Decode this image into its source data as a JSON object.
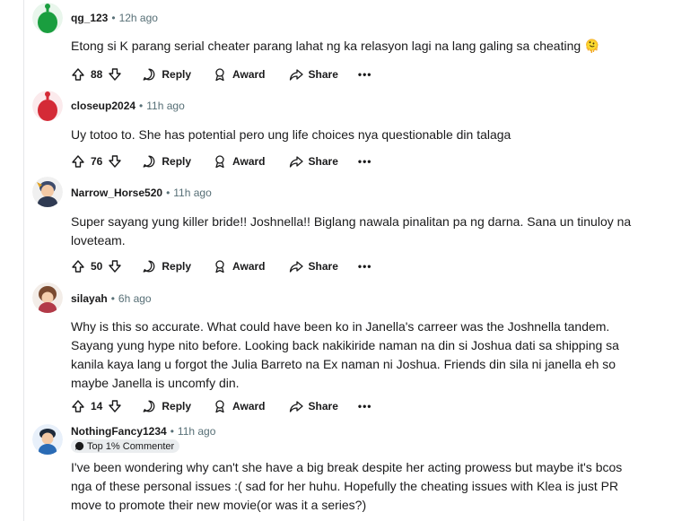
{
  "actions": {
    "reply_label": "Reply",
    "award_label": "Award",
    "share_label": "Share",
    "more_label": "•••"
  },
  "comments": [
    {
      "username": "qg_123",
      "separator": "•",
      "time": "12h ago",
      "text": "Etong si K parang serial cheater parang lahat ng ka relasyon lagi na lang galing sa cheating 🫠",
      "score": "88",
      "avatar_color": "#1a9e3f"
    },
    {
      "username": "closeup2024",
      "separator": "•",
      "time": "11h ago",
      "text": "Uy totoo to. She has potential pero ung life choices nya questionable din talaga",
      "score": "76",
      "avatar_color": "#d42a36"
    },
    {
      "username": "Narrow_Horse520",
      "separator": "•",
      "time": "11h ago",
      "text": "Super sayang yung killer bride!! Joshnella!! Biglang nawala pinalitan pa ng darna. Sana un tinuloy na loveteam.",
      "score": "50",
      "avatar_color": "#3d4b6b"
    },
    {
      "username": "silayah",
      "separator": "•",
      "time": "6h ago",
      "text": "Why is this so accurate. What could have been ko in Janella's carreer was the Joshnella tandem. Sayang yung hype nito before. Looking back nakikiride naman na din si Joshua dati sa shipping sa kanila kaya lang u forgot the Julia Barreto na Ex naman ni Joshua. Friends din sila ni janella eh so maybe Janella is uncomfy din.",
      "score": "14",
      "avatar_color": "#7a4a30"
    },
    {
      "username": "NothingFancy1234",
      "separator": "•",
      "time": "11h ago",
      "badge": "Top 1% Commenter",
      "text": "I've been wondering why can't she have a big break despite her acting prowess but maybe it's bcos nga of these personal issues :( sad for her huhu. Hopefully the cheating issues with Klea is just PR move to promote their new movie(or was it a series?)",
      "avatar_color": "#2a6bb5"
    }
  ],
  "colors": {
    "meta_gray": "#576f76",
    "thread_line": "#e5e7ea",
    "badge_bg": "#eaedef"
  }
}
